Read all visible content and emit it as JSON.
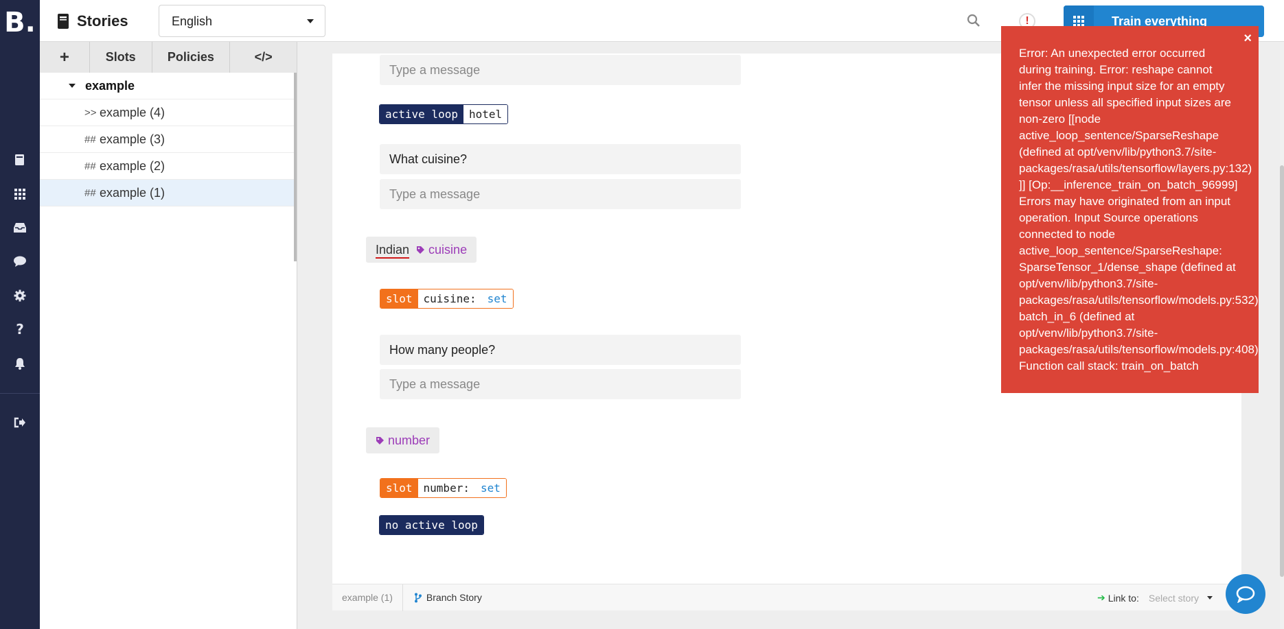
{
  "app": {
    "logo": "B."
  },
  "rail": {
    "icons": [
      "stories-icon",
      "nlu-icon",
      "incoming-icon",
      "conversations-icon",
      "settings-icon",
      "help-icon",
      "notifications-icon",
      "logout-icon"
    ]
  },
  "header": {
    "title": "Stories",
    "language": "English",
    "alert_glyph": "!",
    "train_label": "Train everything"
  },
  "sidebar": {
    "tabs": [
      {
        "label": "+"
      },
      {
        "label": "Slots"
      },
      {
        "label": "Policies"
      },
      {
        "label": "</>"
      }
    ],
    "group": "example",
    "stories": [
      {
        "prefix": ">>",
        "label": "example (4)"
      },
      {
        "prefix": "##",
        "label": "example (3)"
      },
      {
        "prefix": "##",
        "label": "example (2)"
      },
      {
        "prefix": "##",
        "label": "example (1)"
      }
    ]
  },
  "story": {
    "placeholder": "Type a message",
    "loop1": {
      "key": "active loop",
      "value": "hotel"
    },
    "bot1": "What cuisine?",
    "user1": {
      "text": "Indian",
      "entity": "cuisine"
    },
    "slot1": {
      "key": "slot",
      "name": "cuisine:",
      "state": "set"
    },
    "bot2": "How many people?",
    "user2": {
      "entity": "number"
    },
    "slot2": {
      "key": "slot",
      "name": "number:",
      "state": "set"
    },
    "loop2": {
      "key": "no active loop"
    }
  },
  "footer": {
    "story_name": "example (1)",
    "branch_label": "Branch Story",
    "link_label": "Link to:",
    "link_placeholder": "Select story"
  },
  "error": {
    "close": "×",
    "lines": [
      "Error: An unexpected error occurred",
      "during training. Error: reshape cannot",
      "infer the missing input size for an empty",
      "tensor unless all specified input sizes are",
      "non-zero [[node",
      "active_loop_sentence/SparseReshape",
      "(defined at opt/venv/lib/python3.7/site-",
      "packages/rasa/utils/tensorflow/layers.py:132)",
      "]] [Op:__inference_train_on_batch_96999]",
      "Errors may have originated from an input",
      "operation. Input Source operations",
      "connected to node",
      "active_loop_sentence/SparseReshape:",
      "SparseTensor_1/dense_shape (defined at",
      "opt/venv/lib/python3.7/site-",
      "packages/rasa/utils/tensorflow/models.py:532)",
      "batch_in_6 (defined at",
      "opt/venv/lib/python3.7/site-",
      "packages/rasa/utils/tensorflow/models.py:408)",
      "Function call stack: train_on_batch"
    ]
  },
  "colors": {
    "rail": "#212845",
    "accent": "#2185d0",
    "error": "#db4437",
    "slot": "#f2711c",
    "loop": "#1b2b5e",
    "entity": "#9c3cb8"
  }
}
